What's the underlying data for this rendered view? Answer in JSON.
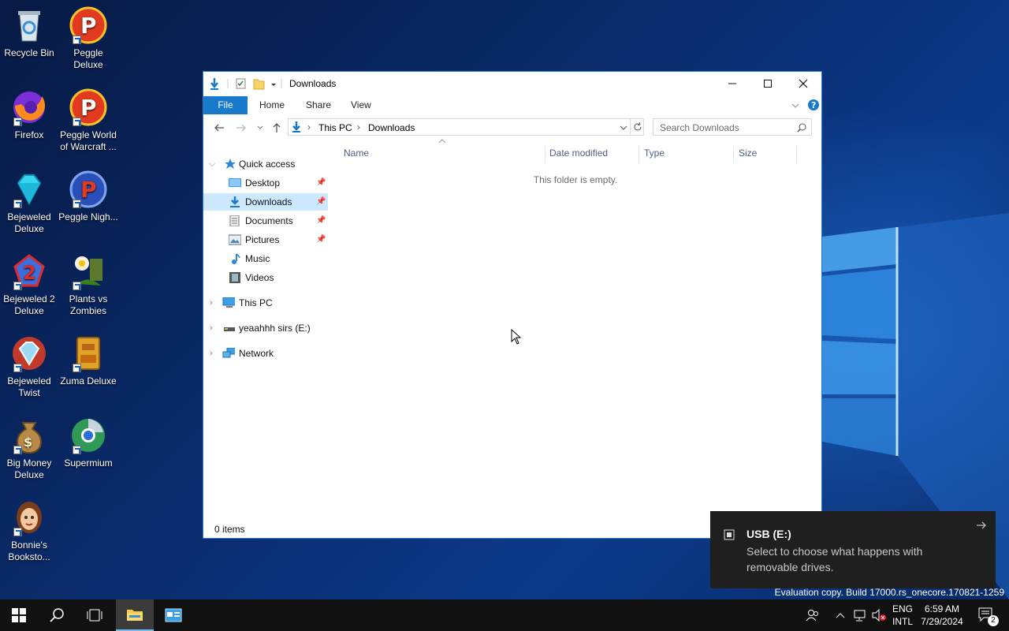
{
  "desktop": {
    "icons": [
      {
        "label": "Recycle Bin",
        "icon": "recycle-bin-icon"
      },
      {
        "label": "Peggle Deluxe",
        "icon": "peggle-icon"
      },
      {
        "label": "Firefox",
        "icon": "firefox-icon"
      },
      {
        "label": "Peggle World of Warcraft ...",
        "icon": "peggle-icon"
      },
      {
        "label": "Bejeweled Deluxe",
        "icon": "gem-icon"
      },
      {
        "label": "Peggle Nigh...",
        "icon": "peggle-icon"
      },
      {
        "label": "Bejeweled 2 Deluxe",
        "icon": "gem-icon"
      },
      {
        "label": "Plants vs Zombies",
        "icon": "flower-icon"
      },
      {
        "label": "Bejeweled Twist",
        "icon": "gem-icon"
      },
      {
        "label": "Zuma Deluxe",
        "icon": "zuma-icon"
      },
      {
        "label": "Big Money Deluxe",
        "icon": "money-bag-icon"
      },
      {
        "label": "Supermium",
        "icon": "browser-icon"
      },
      {
        "label": "Bonnie's Booksto...",
        "icon": "bonnie-icon"
      }
    ]
  },
  "explorer": {
    "title": "Downloads",
    "tabs": {
      "file": "File",
      "home": "Home",
      "share": "Share",
      "view": "View"
    },
    "breadcrumb": [
      "This PC",
      "Downloads"
    ],
    "search_placeholder": "Search Downloads",
    "nav": {
      "quick_access": "Quick access",
      "pinned": [
        "Desktop",
        "Downloads",
        "Documents",
        "Pictures"
      ],
      "unpinned": [
        "Music",
        "Videos"
      ],
      "this_pc": "This PC",
      "drive": "yeaahhh sirs (E:)",
      "network": "Network"
    },
    "columns": [
      "Name",
      "Date modified",
      "Type",
      "Size"
    ],
    "empty_message": "This folder is empty.",
    "status": "0 items"
  },
  "notification": {
    "title": "USB (E:)",
    "body": "Select to choose what happens with removable drives."
  },
  "eval_text": "Evaluation copy. Build 17000.rs_onecore.170821-1259",
  "taskbar": {
    "lang_top": "ENG",
    "lang_bottom": "INTL",
    "time": "6:59 AM",
    "date": "7/29/2024",
    "notification_count": "2"
  },
  "colors": {
    "accent": "#1979ca",
    "selection": "#cce8ff",
    "taskbar": "#111111",
    "toast": "#1f1f1f"
  }
}
